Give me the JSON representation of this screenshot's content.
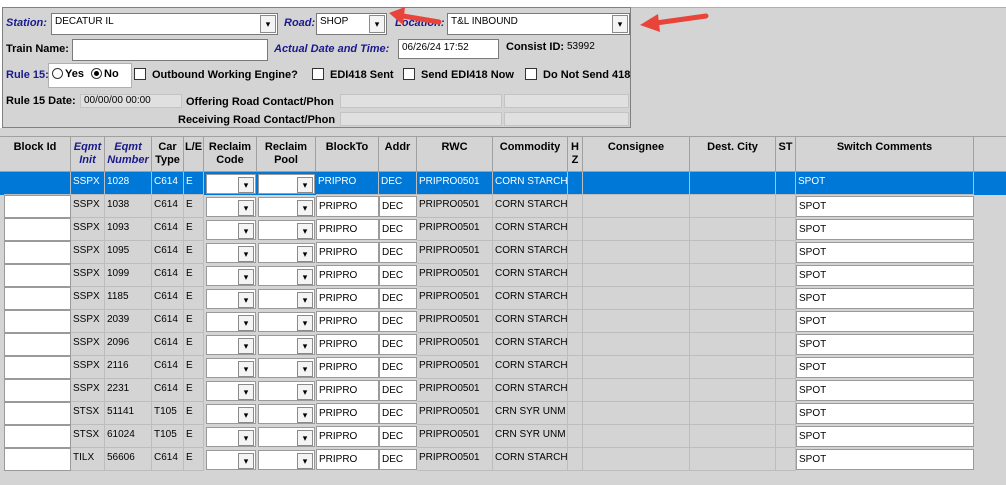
{
  "header": {
    "station_label": "Station:",
    "station_value": "DECATUR IL",
    "road_label": "Road:",
    "road_value": "SHOP",
    "location_label": "Location:",
    "location_value": "T&L INBOUND",
    "train_name_label": "Train Name:",
    "train_name_value": "",
    "actual_dt_label": "Actual Date and Time:",
    "actual_dt_value": "06/26/24 17:52",
    "consist_id_label": "Consist ID:",
    "consist_id_value": "53992",
    "rule15_label": "Rule 15:",
    "rule15_yes": "Yes",
    "rule15_no": "No",
    "outbound_engine_label": "Outbound Working Engine?",
    "edi418_sent_label": "EDI418 Sent",
    "send_edi418_label": "Send EDI418 Now",
    "do_not_send_label": "Do Not Send 418",
    "rule15_date_label": "Rule 15 Date:",
    "rule15_date_value": "00/00/00 00:00",
    "offering_contact_label": "Offering Road Contact/Phon",
    "receiving_contact_label": "Receiving Road Contact/Phon"
  },
  "grid": {
    "columns": {
      "block_id": "Block Id",
      "eqmt_init": "Eqmt Init",
      "eqmt_number": "Eqmt Number",
      "car_type": "Car Type",
      "le": "L/E",
      "reclaim_code": "Reclaim Code",
      "reclaim_pool": "Reclaim Pool",
      "block_to": "BlockTo",
      "addr": "Addr",
      "rwc": "RWC",
      "commodity": "Commodity",
      "hz": "H Z",
      "consignee": "Consignee",
      "dest_city": "Dest. City",
      "st": "ST",
      "switch_comments": "Switch Comments"
    },
    "rows": [
      {
        "init": "SSPX",
        "num": "1028",
        "type": "C614",
        "le": "E",
        "blockto": "PRIPRO",
        "addr": "DEC",
        "rwc": "PRIPRO0501",
        "commodity": "CORN STARCH",
        "comments": "SPOT"
      },
      {
        "init": "SSPX",
        "num": "1038",
        "type": "C614",
        "le": "E",
        "blockto": "PRIPRO",
        "addr": "DEC",
        "rwc": "PRIPRO0501",
        "commodity": "CORN STARCH",
        "comments": "SPOT"
      },
      {
        "init": "SSPX",
        "num": "1093",
        "type": "C614",
        "le": "E",
        "blockto": "PRIPRO",
        "addr": "DEC",
        "rwc": "PRIPRO0501",
        "commodity": "CORN STARCH",
        "comments": "SPOT"
      },
      {
        "init": "SSPX",
        "num": "1095",
        "type": "C614",
        "le": "E",
        "blockto": "PRIPRO",
        "addr": "DEC",
        "rwc": "PRIPRO0501",
        "commodity": "CORN STARCH",
        "comments": "SPOT"
      },
      {
        "init": "SSPX",
        "num": "1099",
        "type": "C614",
        "le": "E",
        "blockto": "PRIPRO",
        "addr": "DEC",
        "rwc": "PRIPRO0501",
        "commodity": "CORN STARCH",
        "comments": "SPOT"
      },
      {
        "init": "SSPX",
        "num": "1185",
        "type": "C614",
        "le": "E",
        "blockto": "PRIPRO",
        "addr": "DEC",
        "rwc": "PRIPRO0501",
        "commodity": "CORN STARCH",
        "comments": "SPOT"
      },
      {
        "init": "SSPX",
        "num": "2039",
        "type": "C614",
        "le": "E",
        "blockto": "PRIPRO",
        "addr": "DEC",
        "rwc": "PRIPRO0501",
        "commodity": "CORN STARCH",
        "comments": "SPOT"
      },
      {
        "init": "SSPX",
        "num": "2096",
        "type": "C614",
        "le": "E",
        "blockto": "PRIPRO",
        "addr": "DEC",
        "rwc": "PRIPRO0501",
        "commodity": "CORN STARCH",
        "comments": "SPOT"
      },
      {
        "init": "SSPX",
        "num": "2116",
        "type": "C614",
        "le": "E",
        "blockto": "PRIPRO",
        "addr": "DEC",
        "rwc": "PRIPRO0501",
        "commodity": "CORN STARCH",
        "comments": "SPOT"
      },
      {
        "init": "SSPX",
        "num": "2231",
        "type": "C614",
        "le": "E",
        "blockto": "PRIPRO",
        "addr": "DEC",
        "rwc": "PRIPRO0501",
        "commodity": "CORN STARCH",
        "comments": "SPOT"
      },
      {
        "init": "STSX",
        "num": "51141",
        "type": "T105",
        "le": "E",
        "blockto": "PRIPRO",
        "addr": "DEC",
        "rwc": "PRIPRO0501",
        "commodity": "CRN SYR UNM",
        "comments": "SPOT"
      },
      {
        "init": "STSX",
        "num": "61024",
        "type": "T105",
        "le": "E",
        "blockto": "PRIPRO",
        "addr": "DEC",
        "rwc": "PRIPRO0501",
        "commodity": "CRN SYR UNM",
        "comments": "SPOT"
      },
      {
        "init": "TILX",
        "num": "56606",
        "type": "C614",
        "le": "E",
        "blockto": "PRIPRO",
        "addr": "DEC",
        "rwc": "PRIPRO0501",
        "commodity": "CORN STARCH",
        "comments": "SPOT"
      }
    ]
  },
  "icons": {
    "dropdown": "▾"
  },
  "colors": {
    "selection": "#0078d7",
    "label_blue": "#1a1a8c",
    "annotation_arrow": "#e8443a"
  }
}
